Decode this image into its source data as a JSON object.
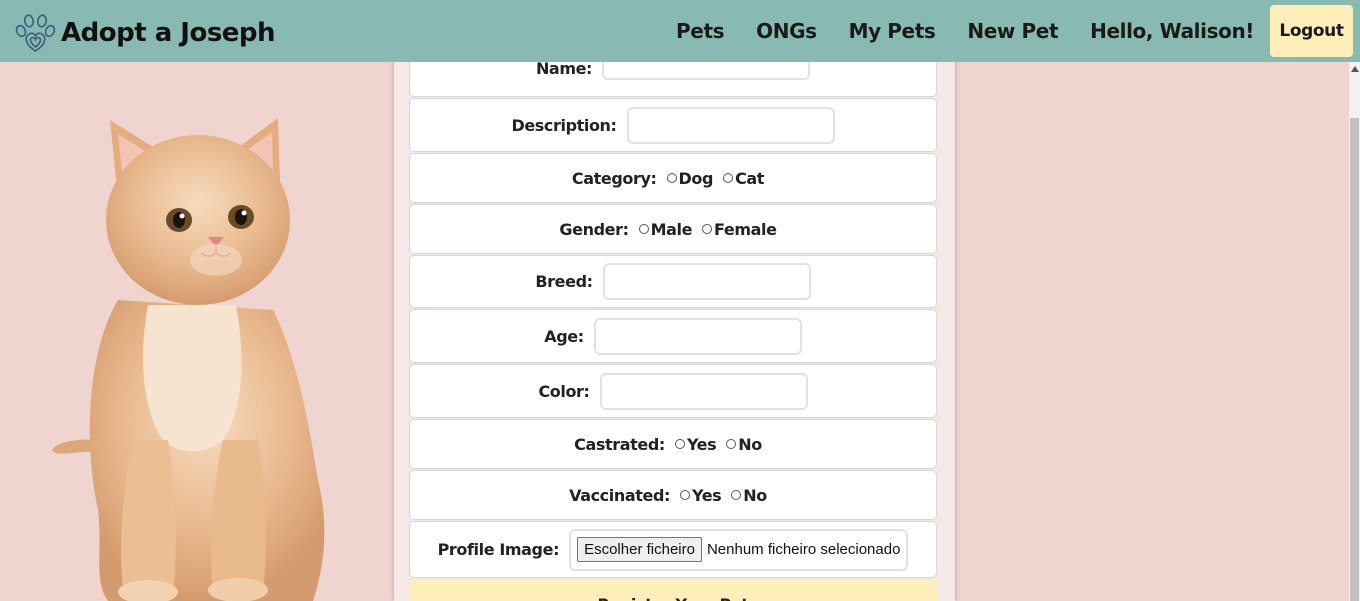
{
  "brand": {
    "title": "Adopt a Joseph",
    "logo_icon": "paw-heart-icon"
  },
  "nav": {
    "links": [
      "Pets",
      "ONGs",
      "My Pets",
      "New Pet"
    ],
    "greeting": "Hello, Walison!",
    "logout_label": "Logout"
  },
  "form": {
    "name_label": "Name:",
    "description_label": "Description:",
    "category": {
      "label": "Category:",
      "options": [
        "Dog",
        "Cat"
      ]
    },
    "gender": {
      "label": "Gender:",
      "options": [
        "Male",
        "Female"
      ]
    },
    "breed_label": "Breed:",
    "age_label": "Age:",
    "color_label": "Color:",
    "castrated": {
      "label": "Castrated:",
      "options": [
        "Yes",
        "No"
      ]
    },
    "vaccinated": {
      "label": "Vaccinated:",
      "options": [
        "Yes",
        "No"
      ]
    },
    "profile_image": {
      "label": "Profile Image:",
      "button_label": "Escolher ficheiro",
      "status": "Nenhum ficheiro selecionado"
    },
    "submit_label": "Register Your Pet"
  },
  "colors": {
    "navbar": "#88b9b2",
    "page_background": "#f0d4cf",
    "panel_background": "#f6e8e7",
    "accent_button": "#fdeeba"
  }
}
